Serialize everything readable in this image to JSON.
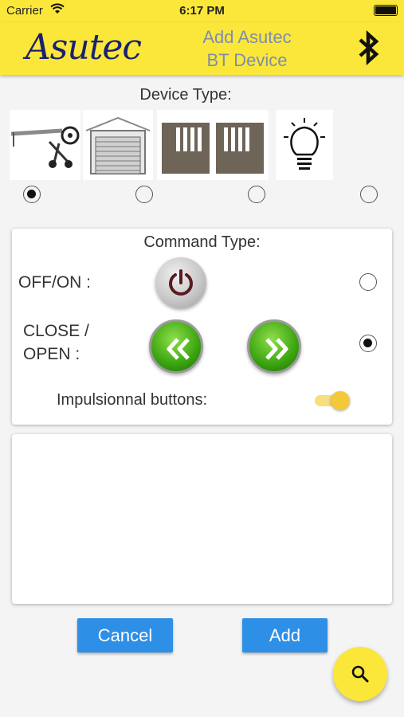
{
  "status_bar": {
    "carrier": "Carrier",
    "time": "6:17 PM"
  },
  "app_bar": {
    "logo_text": "Asutec",
    "title_line1": "Add Asutec",
    "title_line2": "BT Device",
    "action_icon": "bluetooth-icon"
  },
  "device_type": {
    "label": "Device Type:",
    "options": [
      {
        "name": "pool-cover-roller",
        "selected": true
      },
      {
        "name": "garage-door",
        "selected": false
      },
      {
        "name": "gate",
        "selected": false
      },
      {
        "name": "light-bulb",
        "selected": false
      }
    ]
  },
  "command_type": {
    "title": "Command Type:",
    "off_on_label": "OFF/ON :",
    "close_open_label_line1": "CLOSE /",
    "close_open_label_line2": "OPEN :",
    "selected": "close_open",
    "impulsional_label": "Impulsionnal buttons:",
    "impulsional_enabled": true
  },
  "buttons": {
    "cancel": "Cancel",
    "add": "Add"
  },
  "fab_icon": "search-icon",
  "colors": {
    "app_bar": "#fbe73a",
    "title_text": "#7f8cad",
    "logo_text": "#1b2170",
    "primary_button": "#2d8fe6",
    "toggle_on": "#f3c93a"
  }
}
